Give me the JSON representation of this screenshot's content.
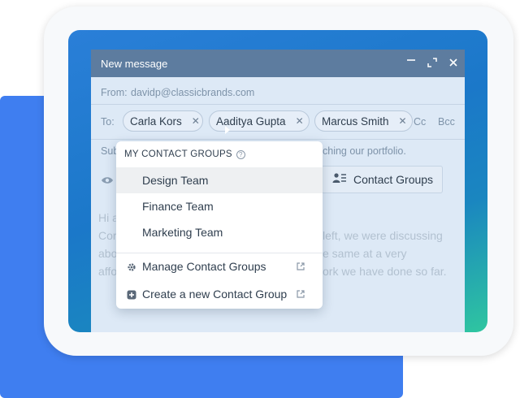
{
  "window": {
    "title": "New message"
  },
  "compose": {
    "from_label": "From:",
    "from_value": "davidp@classicbrands.com",
    "to_label": "To:",
    "recipients": [
      {
        "name": "Carla Kors"
      },
      {
        "name": "Aaditya Gupta"
      },
      {
        "name": "Marcus Smith"
      }
    ],
    "cc_label": "Cc",
    "bcc_label": "Bcc",
    "subject_partial_left": "Sub",
    "subject_partial_right": "ching our portfolio.",
    "contact_groups_button": "Contact Groups",
    "body_lines_left": [
      "Hi a",
      "Cor",
      "abo",
      "affo"
    ],
    "body_lines_right": [
      "left, we were discussing",
      "e same at a very",
      "ork we have done so far."
    ]
  },
  "dropdown": {
    "header": "MY CONTACT GROUPS",
    "help_glyph": "?",
    "groups": [
      "Design Team",
      "Finance Team",
      "Marketing Team"
    ],
    "actions": [
      {
        "label": "Manage Contact Groups",
        "icon": "gear-icon"
      },
      {
        "label": "Create a new Contact Group",
        "icon": "plus-square-icon"
      }
    ]
  },
  "colors": {
    "accent_blue": "#3f7ef0",
    "titlebar": "#5d7c9f"
  }
}
